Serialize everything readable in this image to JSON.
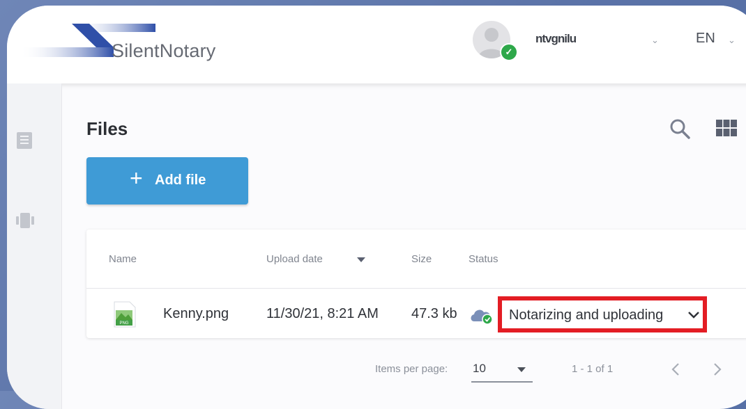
{
  "header": {
    "brand": "SilentNotary",
    "username": "ntvgnilu",
    "language": "EN"
  },
  "page": {
    "title": "Files",
    "add_button_label": "Add file"
  },
  "table": {
    "columns": [
      "Name",
      "Upload date",
      "Size",
      "Status"
    ],
    "rows": [
      {
        "name": "Kenny.png",
        "upload_date": "11/30/21, 8:21 AM",
        "size": "47.3 kb",
        "status": "Notarizing and uploading"
      }
    ]
  },
  "pagination": {
    "items_per_page_label": "Items per page:",
    "items_per_page": "10",
    "range": "1 - 1 of 1"
  },
  "icons": {
    "sidebar": [
      "files-icon",
      "devices-icon"
    ],
    "toolbar": [
      "search-icon",
      "grid-view-icon"
    ]
  },
  "colors": {
    "accent": "#3f9bd6",
    "highlight": "#e31d24",
    "verified": "#2ea84a"
  }
}
